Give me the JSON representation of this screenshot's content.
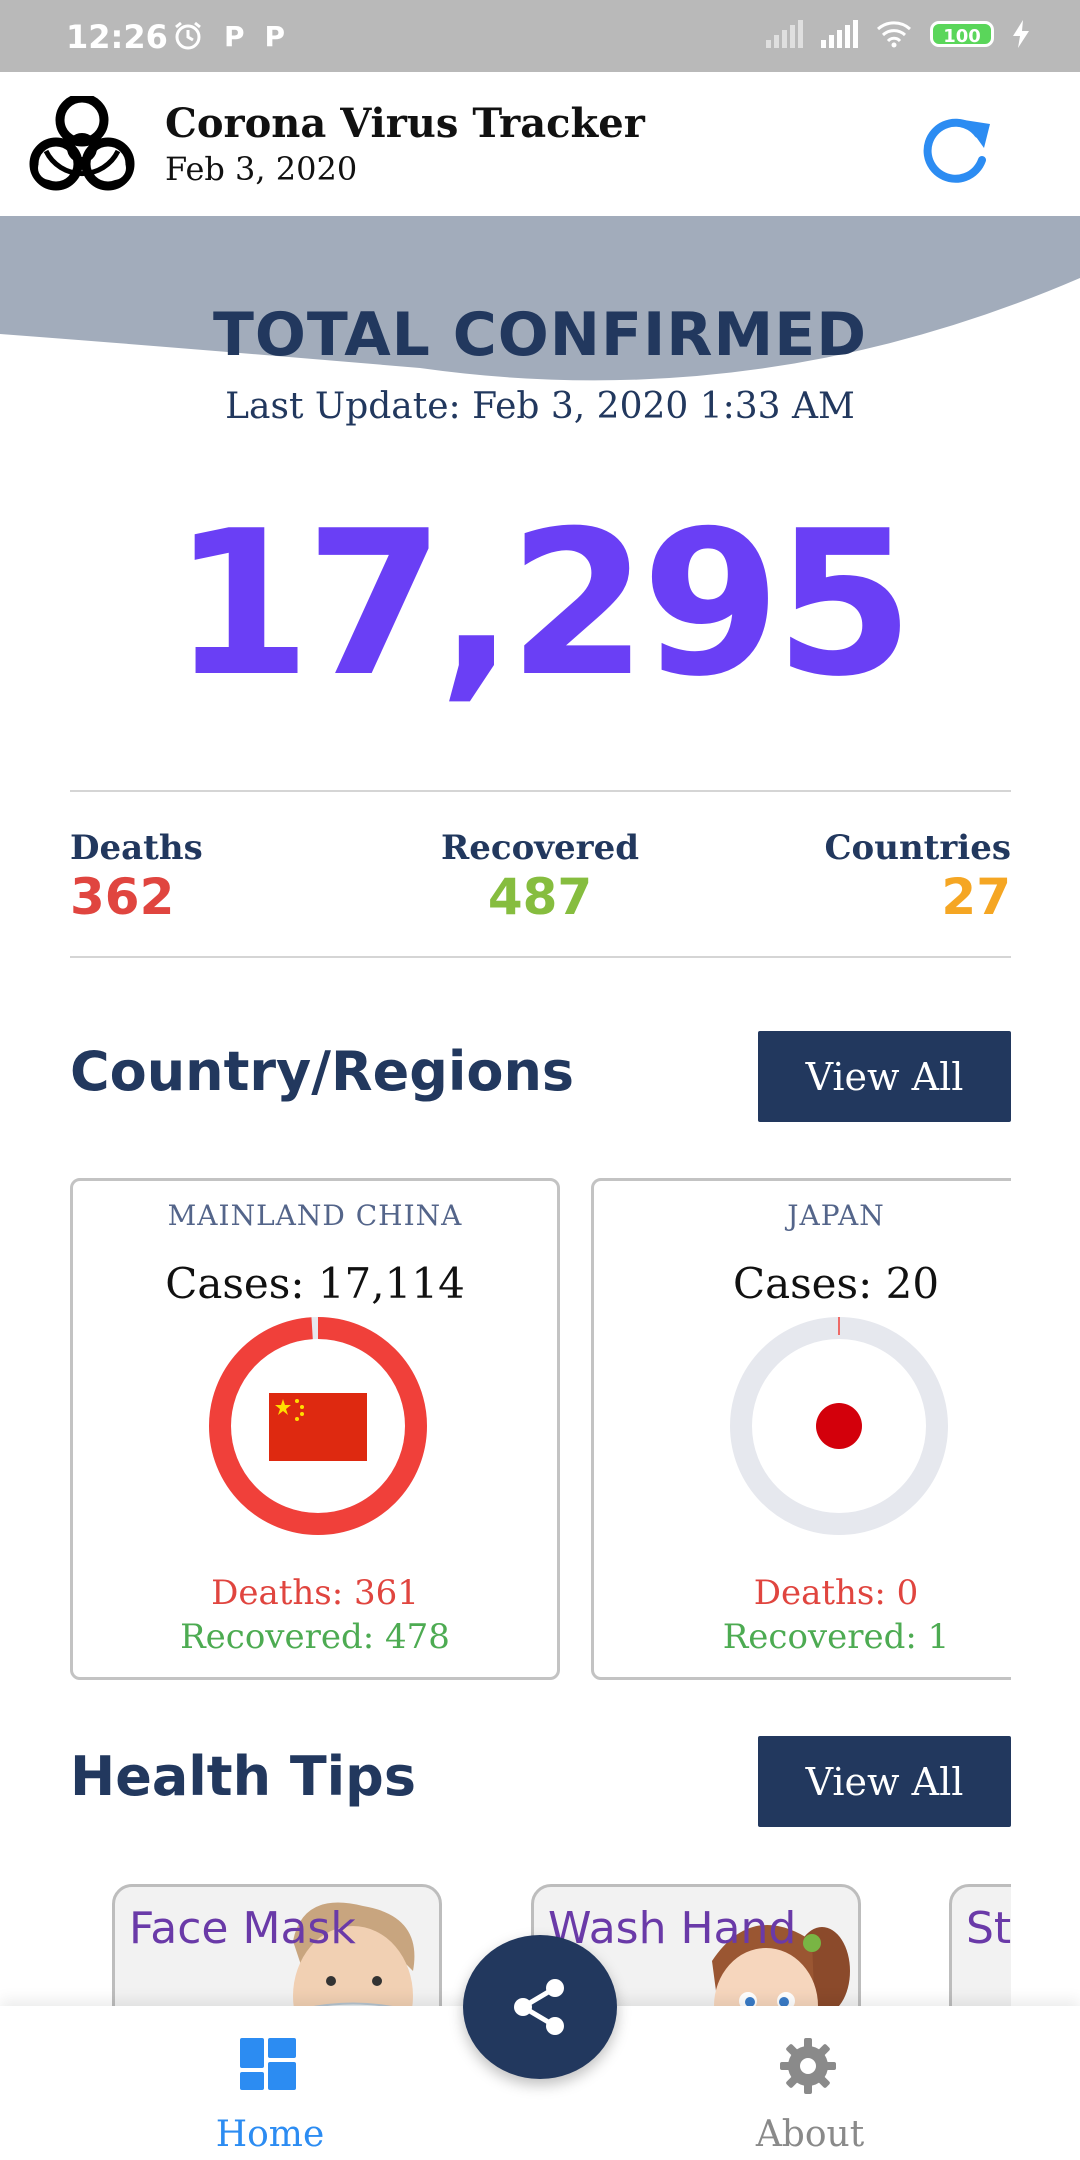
{
  "status_bar": {
    "time": "12:26",
    "notif_icons": [
      "alarm-icon",
      "parking-icon",
      "parking-icon"
    ],
    "parking_glyph": "P",
    "battery": "100"
  },
  "header": {
    "title": "Corona Virus Tracker",
    "date": "Feb 3, 2020",
    "logo_icon": "biohazard-icon",
    "refresh_icon": "refresh-icon"
  },
  "summary": {
    "title": "TOTAL CONFIRMED",
    "last_update": "Last Update: Feb 3, 2020 1:33 AM",
    "total": "17,295",
    "deaths_label": "Deaths",
    "deaths": "362",
    "recovered_label": "Recovered",
    "recovered": "487",
    "countries_label": "Countries",
    "countries": "27"
  },
  "regions": {
    "title": "Country/Regions",
    "view_all": "View All",
    "cards": [
      {
        "country": "MAINLAND CHINA",
        "cases": "Cases: 17,114",
        "deaths": "Deaths: 361",
        "recovered": "Recovered: 478",
        "share_of_total": 0.99
      },
      {
        "country": "JAPAN",
        "cases": "Cases: 20",
        "deaths": "Deaths: 0",
        "recovered": "Recovered: 1",
        "share_of_total": 0.001
      }
    ]
  },
  "health_tips": {
    "title": "Health Tips",
    "view_all": "View All",
    "tips": [
      {
        "label": "Face Mask"
      },
      {
        "label": "Wash Hand"
      },
      {
        "label": "Sta"
      }
    ]
  },
  "bottom_nav": {
    "home": "Home",
    "about": "About",
    "share_icon": "share-icon"
  },
  "colors": {
    "navy": "#22385e",
    "purple": "#6a3ff5",
    "deaths": "#e0453f",
    "recovered": "#86bd3f",
    "countries": "#f5a623",
    "home_active": "#2c8cf2",
    "about_inactive": "#8a8a8a"
  }
}
